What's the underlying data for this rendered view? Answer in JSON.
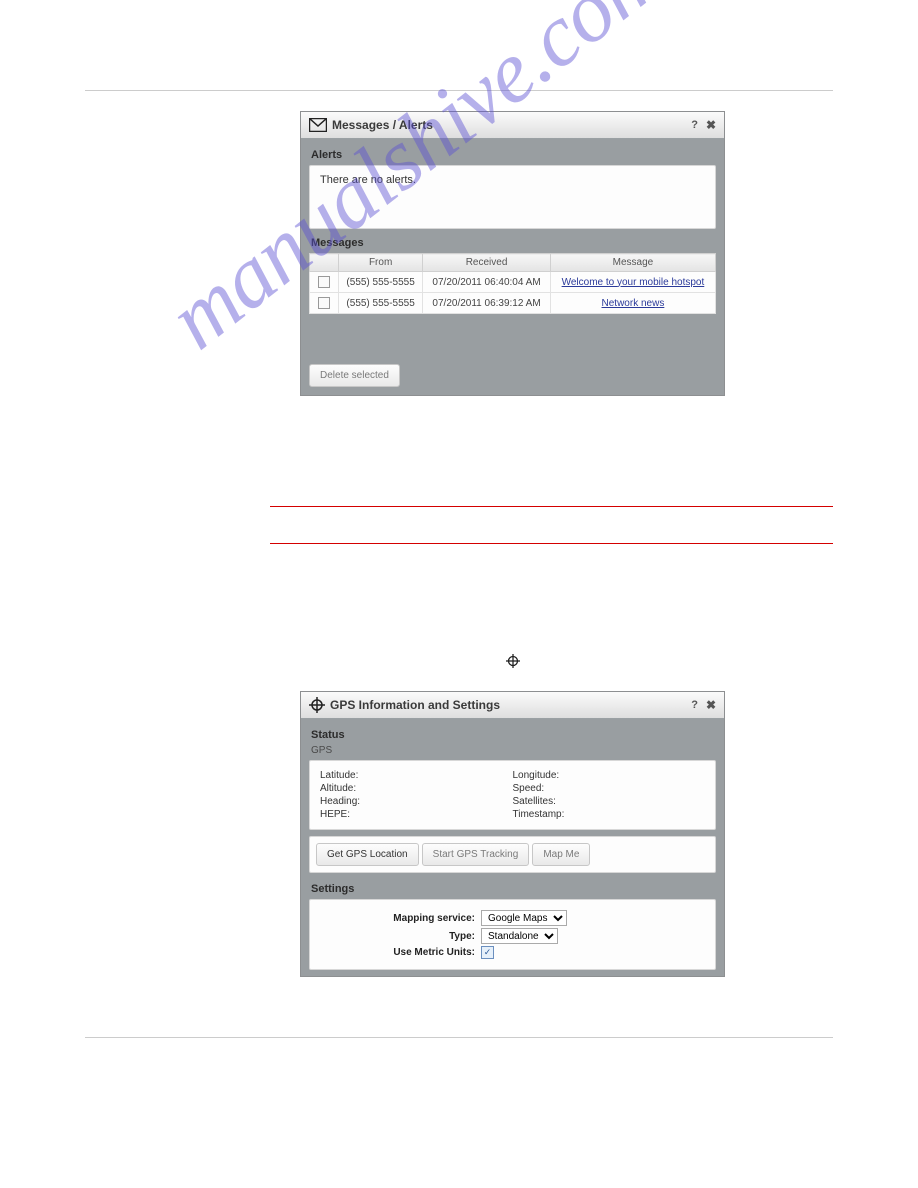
{
  "watermark": "manualshive.com",
  "panel1": {
    "title": "Messages / Alerts",
    "alerts_heading": "Alerts",
    "alerts_empty": "There are no alerts.",
    "messages_heading": "Messages",
    "columns": {
      "from": "From",
      "received": "Received",
      "message": "Message"
    },
    "rows": [
      {
        "from": "(555) 555-5555",
        "received": "07/20/2011 06:40:04 AM",
        "message": "Welcome to your mobile hotspot"
      },
      {
        "from": "(555) 555-5555",
        "received": "07/20/2011 06:39:12 AM",
        "message": "Network news"
      }
    ],
    "delete_btn": "Delete selected"
  },
  "panel2": {
    "title": "GPS Information and Settings",
    "status_heading": "Status",
    "status_sub": "GPS",
    "fields": {
      "latitude": "Latitude:",
      "longitude": "Longitude:",
      "altitude": "Altitude:",
      "speed": "Speed:",
      "heading": "Heading:",
      "satellites": "Satellites:",
      "hepe": "HEPE:",
      "timestamp": "Timestamp:"
    },
    "buttons": {
      "get": "Get GPS Location",
      "start": "Start GPS Tracking",
      "map": "Map Me"
    },
    "settings_heading": "Settings",
    "settings": {
      "mapping_label": "Mapping service:",
      "mapping_value": "Google Maps",
      "type_label": "Type:",
      "type_value": "Standalone",
      "metric_label": "Use Metric Units:"
    }
  }
}
